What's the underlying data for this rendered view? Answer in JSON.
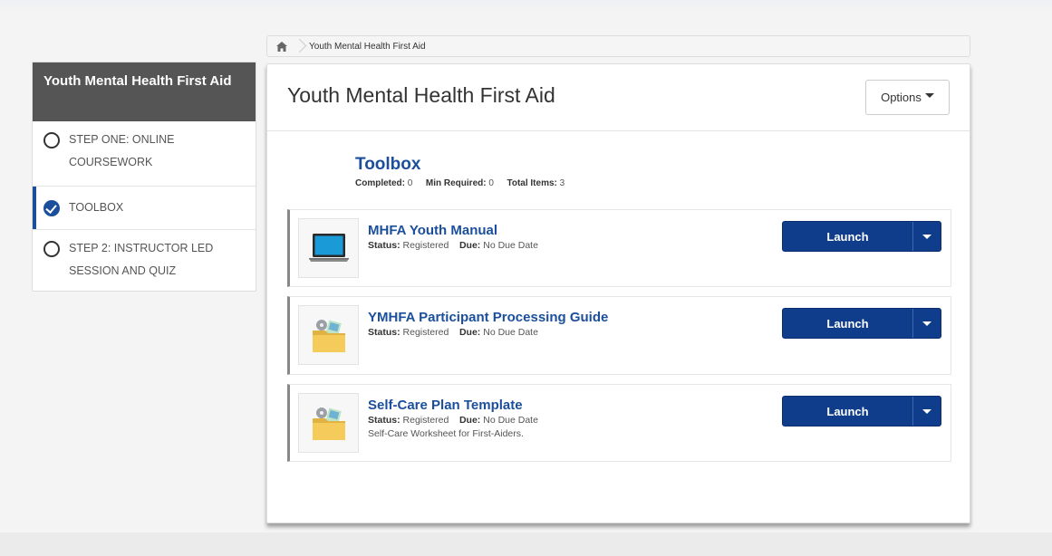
{
  "breadcrumb": {
    "home_icon": "home-icon",
    "current": "Youth Mental Health First Aid"
  },
  "sidebar": {
    "title": "Youth Mental Health First Aid",
    "items": [
      {
        "label": "STEP ONE: ONLINE COURSEWORK",
        "icon": "radio-empty-icon",
        "active": false
      },
      {
        "label": "TOOLBOX",
        "icon": "check-circle-icon",
        "active": true
      },
      {
        "label": "STEP 2: INSTRUCTOR LED SESSION AND QUIZ",
        "icon": "radio-empty-icon",
        "active": false
      }
    ]
  },
  "main": {
    "title": "Youth Mental Health First Aid",
    "options_label": "Options"
  },
  "section": {
    "title": "Toolbox",
    "completed_label": "Completed:",
    "completed_value": "0",
    "min_required_label": "Min Required:",
    "min_required_value": "0",
    "total_items_label": "Total Items:",
    "total_items_value": "3"
  },
  "items": [
    {
      "title": "MHFA Youth Manual",
      "status_label": "Status:",
      "status": "Registered",
      "due_label": "Due:",
      "due": "No Due Date",
      "description": "",
      "thumb_icon": "laptop-icon",
      "launch_label": "Launch"
    },
    {
      "title": "YMHFA Participant Processing Guide",
      "status_label": "Status:",
      "status": "Registered",
      "due_label": "Due:",
      "due": "No Due Date",
      "description": "",
      "thumb_icon": "folder-media-icon",
      "launch_label": "Launch"
    },
    {
      "title": "Self-Care Plan Template",
      "status_label": "Status:",
      "status": "Registered",
      "due_label": "Due:",
      "due": "No Due Date",
      "description": "Self-Care Worksheet for First-Aiders.",
      "thumb_icon": "folder-media-icon",
      "launch_label": "Launch"
    }
  ],
  "colors": {
    "accent": "#1b4f9c",
    "launch_button": "#0f3d8c",
    "sidebar_header": "#555555"
  }
}
